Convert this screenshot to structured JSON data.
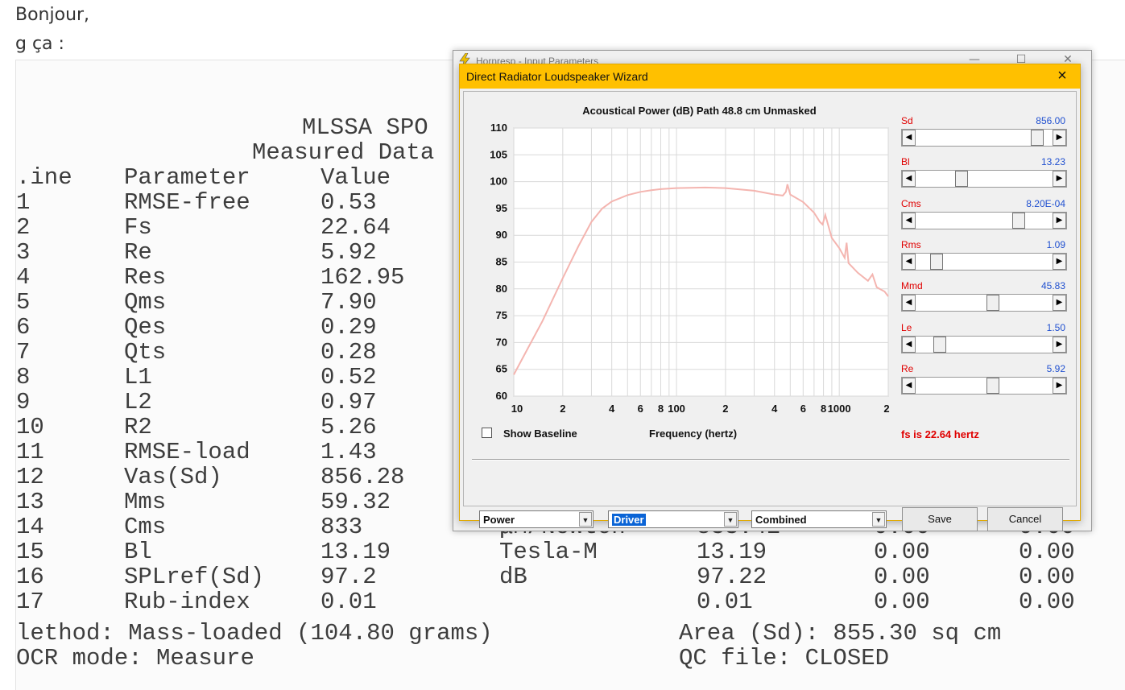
{
  "post": {
    "line1": "Bonjour,",
    "line2": "g ça :"
  },
  "scan": {
    "title1": "MLSSA SPO",
    "title2": "Measured Data",
    "header": {
      "line": ".ine",
      "param": "Parameter",
      "value": "Value"
    },
    "rows": [
      {
        "line": "1",
        "param": "RMSE-free",
        "value": "0.53"
      },
      {
        "line": "2",
        "param": "Fs",
        "value": "22.64"
      },
      {
        "line": "3",
        "param": "Re",
        "value": "5.92"
      },
      {
        "line": "4",
        "param": "Res",
        "value": "162.95"
      },
      {
        "line": "5",
        "param": "Qms",
        "value": "7.90"
      },
      {
        "line": "6",
        "param": "Qes",
        "value": "0.29"
      },
      {
        "line": "7",
        "param": "Qts",
        "value": "0.28"
      },
      {
        "line": "8",
        "param": "L1",
        "value": "0.52"
      },
      {
        "line": "9",
        "param": "L2",
        "value": "0.97"
      },
      {
        "line": "10",
        "param": "R2",
        "value": "5.26"
      },
      {
        "line": "11",
        "param": "RMSE-load",
        "value": "1.43"
      },
      {
        "line": "12",
        "param": "Vas(Sd)",
        "value": "856.28"
      },
      {
        "line": "13",
        "param": "Mms",
        "value": "59.32"
      },
      {
        "line": "14",
        "param": "Cms",
        "value": "833",
        "unit": "μM/Newton",
        "v2": "833.42",
        "v3": "0.00",
        "v4": "0.00"
      },
      {
        "line": "15",
        "param": "Bl",
        "value": "13.19",
        "unit": "Tesla-M",
        "v2": "13.19",
        "v3": "0.00",
        "v4": "0.00"
      },
      {
        "line": "16",
        "param": "SPLref(Sd)",
        "value": "97.2",
        "unit": "dB",
        "v2": "97.22",
        "v3": "0.00",
        "v4": "0.00"
      },
      {
        "line": "17",
        "param": "Rub-index",
        "value": "0.01",
        "v2": "0.01",
        "v3": "0.00",
        "v4": "0.00"
      }
    ],
    "method": "lethod: Mass-loaded (104.80 grams)",
    "ocr": "OCR mode: Measure",
    "area": "Area (Sd): 855.30 sq cm",
    "qc": "QC file: CLOSED"
  },
  "back_window": {
    "title": "Hornresp - Input Parameters"
  },
  "wizard": {
    "title": "Direct Radiator Loudspeaker Wizard",
    "close_label": "×",
    "chart_title": "Acoustical Power (dB)   Path 48.8 cm   Unmasked",
    "show_baseline_label": "Show Baseline",
    "frequency_label": "Frequency (hertz)",
    "fs_label": "fs is 22.64 hertz",
    "params": [
      {
        "name": "Sd",
        "value": "856.00",
        "position": 0.93
      },
      {
        "name": "Bl",
        "value": "13.23",
        "position": 0.32
      },
      {
        "name": "Cms",
        "value": "8.20E-04",
        "position": 0.78
      },
      {
        "name": "Rms",
        "value": "1.09",
        "position": 0.12
      },
      {
        "name": "Mmd",
        "value": "45.83",
        "position": 0.57
      },
      {
        "name": "Le",
        "value": "1.50",
        "position": 0.14
      },
      {
        "name": "Re",
        "value": "5.92",
        "position": 0.57
      }
    ],
    "combo1": "Power",
    "combo2": "Driver",
    "combo3": "Combined",
    "save_label": "Save",
    "cancel_label": "Cancel",
    "colors": {
      "title_bar": "#ffc000",
      "curve": "#f4b5b0",
      "param_name": "#e00000",
      "param_value": "#2050d0"
    }
  },
  "chart_data": {
    "type": "line",
    "title": "Acoustical Power (dB)   Path 48.8 cm   Unmasked",
    "xlabel": "Frequency (hertz)",
    "ylabel": "",
    "x_scale": "log",
    "xlim": [
      10,
      2000
    ],
    "ylim": [
      60,
      110
    ],
    "x_tick_labels": [
      "10",
      "2",
      "4",
      "6",
      "8",
      "100",
      "2",
      "4",
      "6",
      "8",
      "1000",
      "2"
    ],
    "y_ticks": [
      60,
      65,
      70,
      75,
      80,
      85,
      90,
      95,
      100,
      105,
      110
    ],
    "grid": true,
    "series": [
      {
        "x": [
          10,
          12,
          15,
          20,
          25,
          30,
          35,
          40,
          50,
          60,
          70,
          80,
          100,
          150,
          200,
          300,
          400,
          450,
          470,
          480,
          500,
          600,
          700,
          760,
          790,
          820,
          900,
          1000,
          1080,
          1110,
          1140,
          1300,
          1500,
          1600,
          1700,
          1900,
          2000
        ],
        "y": [
          64,
          68.5,
          74,
          82,
          88,
          92.5,
          95,
          96.3,
          97.5,
          98.1,
          98.4,
          98.6,
          98.8,
          98.9,
          98.8,
          98.3,
          97.6,
          97.4,
          98.1,
          99.5,
          97.6,
          96.2,
          94.2,
          92.5,
          92.0,
          93.8,
          89.5,
          87.6,
          85.8,
          88.6,
          84.8,
          83.0,
          81.5,
          82.7,
          80.3,
          79.5,
          78.6
        ]
      }
    ]
  }
}
